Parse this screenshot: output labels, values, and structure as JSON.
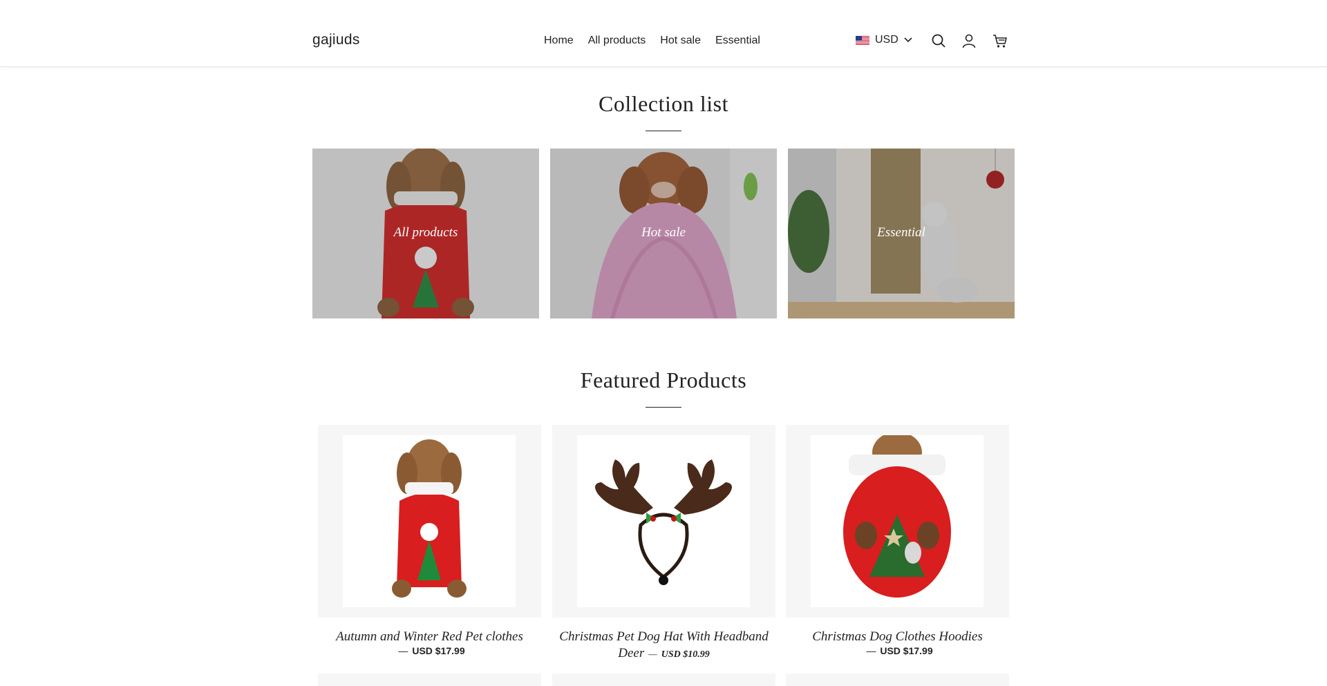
{
  "header": {
    "logo": "gajiuds",
    "nav": [
      "Home",
      "All products",
      "Hot sale",
      "Essential"
    ],
    "currency": "USD",
    "icons": [
      "us-flag-icon",
      "chevron-down-icon",
      "search-icon",
      "account-icon",
      "cart-icon"
    ]
  },
  "collections": {
    "title": "Collection list",
    "items": [
      {
        "label": "All products"
      },
      {
        "label": "Hot sale"
      },
      {
        "label": "Essential"
      }
    ]
  },
  "featured": {
    "title": "Featured Products",
    "products": [
      {
        "name": "Autumn and Winter Red Pet clothes",
        "price": "USD $17.99"
      },
      {
        "name": "Christmas Pet Dog Hat With Headband Deer",
        "price": "USD $10.99"
      },
      {
        "name": "Christmas Dog Clothes Hoodies",
        "price": "USD $17.99"
      }
    ]
  },
  "colors": {
    "text": "#222222",
    "frame": "#f6f6f6",
    "accent_red": "#d81e1e"
  }
}
